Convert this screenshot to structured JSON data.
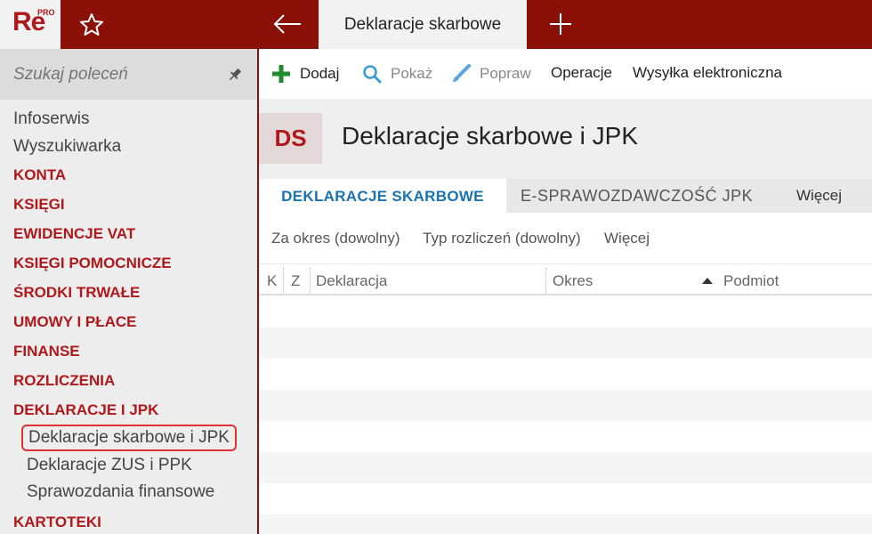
{
  "app": {
    "logo_text": "Re",
    "logo_badge": "PRO"
  },
  "tabs_bar": {
    "active_tab": "Deklaracje skarbowe"
  },
  "sidebar": {
    "search_placeholder": "Szukaj poleceń",
    "items": {
      "infoserwis": "Infoserwis",
      "wyszukiwarka": "Wyszukiwarka",
      "konta": "KONTA",
      "ksiegi": "KSIĘGI",
      "ewidencje_vat": "EWIDENCJE VAT",
      "ksiegi_pomocnicze": "KSIĘGI POMOCNICZE",
      "srodki_trwale": "ŚRODKI TRWAŁE",
      "umowy_i_place": "UMOWY I PŁACE",
      "finanse": "FINANSE",
      "rozliczenia": "ROZLICZENIA",
      "deklaracje_i_jpk": "DEKLARACJE I JPK",
      "deklaracje_skarbowe_i_jpk": "Deklaracje skarbowe i JPK",
      "deklaracje_zus_i_ppk": "Deklaracje ZUS i PPK",
      "sprawozdania_finansowe": "Sprawozdania finansowe",
      "kartoteki": "KARTOTEKI"
    }
  },
  "toolbar": {
    "dodaj": "Dodaj",
    "pokaz": "Pokaż",
    "popraw": "Popraw",
    "operacje": "Operacje",
    "wysylka": "Wysyłka elektroniczna"
  },
  "header": {
    "badge": "DS",
    "title": "Deklaracje skarbowe i JPK"
  },
  "content_tabs": {
    "tab1": "DEKLARACJE SKARBOWE",
    "tab2": "E-SPRAWOZDAWCZOŚĆ JPK",
    "more": "Więcej"
  },
  "filters": {
    "okres": "Za okres (dowolny)",
    "typ": "Typ rozliczeń (dowolny)",
    "more": "Więcej"
  },
  "grid": {
    "columns": {
      "k": "K",
      "z": "Z",
      "deklaracja": "Deklaracja",
      "okres": "Okres",
      "podmiot": "Podmiot"
    }
  },
  "colors": {
    "brand_red": "#8b1008",
    "accent_red": "#b0181b",
    "link_blue": "#1a73b0",
    "add_green": "#1f8a2e"
  }
}
